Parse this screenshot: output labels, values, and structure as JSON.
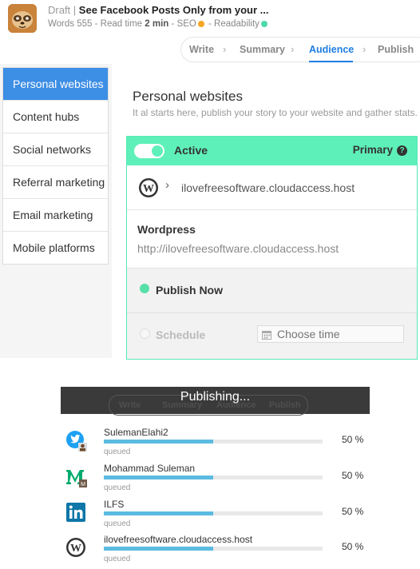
{
  "header": {
    "draft_label": "Draft |",
    "post_title": "See Facebook Posts Only from your ...",
    "words": "Words 555",
    "read_time_prefix": "- Read time",
    "read_time": "2 min",
    "seo_label": "- SEO",
    "readability_label": "- Readability",
    "seo_color": "#f5a623",
    "readability_color": "#4cd9a8"
  },
  "steps": {
    "write": "Write",
    "summary": "Summary",
    "audience": "Audience",
    "publish": "Publish",
    "active": "Audience"
  },
  "sidebar": {
    "items": [
      {
        "label": "Personal websites"
      },
      {
        "label": "Content hubs"
      },
      {
        "label": "Social networks"
      },
      {
        "label": "Referral marketing"
      },
      {
        "label": "Email marketing"
      },
      {
        "label": "Mobile platforms"
      }
    ]
  },
  "main": {
    "title": "Personal websites",
    "subtitle": "It al starts here, publish your story to your website and gather stats."
  },
  "card": {
    "active_label": "Active",
    "primary_label": "Primary",
    "site_url": "ilovefreesoftware.cloudaccess.host",
    "platform_name": "Wordpress",
    "platform_url": "http://ilovefreesoftware.cloudaccess.host",
    "publish_now": "Publish Now",
    "schedule": "Schedule",
    "time_placeholder": "Choose time",
    "accent": "#5ef0b9"
  },
  "publishing": {
    "title": "Publishing...",
    "ghost_steps": {
      "write": "Write",
      "summary": "Summary",
      "audience": "Audience",
      "publish": "Publish"
    },
    "items": [
      {
        "name": "SulemanElahi2",
        "icon": "twitter-icon",
        "status": "queued",
        "percent_label": "50 %",
        "progress": 0.5
      },
      {
        "name": "Mohammad Suleman",
        "icon": "medium-icon",
        "status": "queued",
        "percent_label": "50 %",
        "progress": 0.5
      },
      {
        "name": "ILFS",
        "icon": "linkedin-icon",
        "status": "queued",
        "percent_label": "50 %",
        "progress": 0.5
      },
      {
        "name": "ilovefreesoftware.cloudaccess.host",
        "icon": "wordpress-icon",
        "status": "queued",
        "percent_label": "50 %",
        "progress": 0.5
      }
    ]
  }
}
